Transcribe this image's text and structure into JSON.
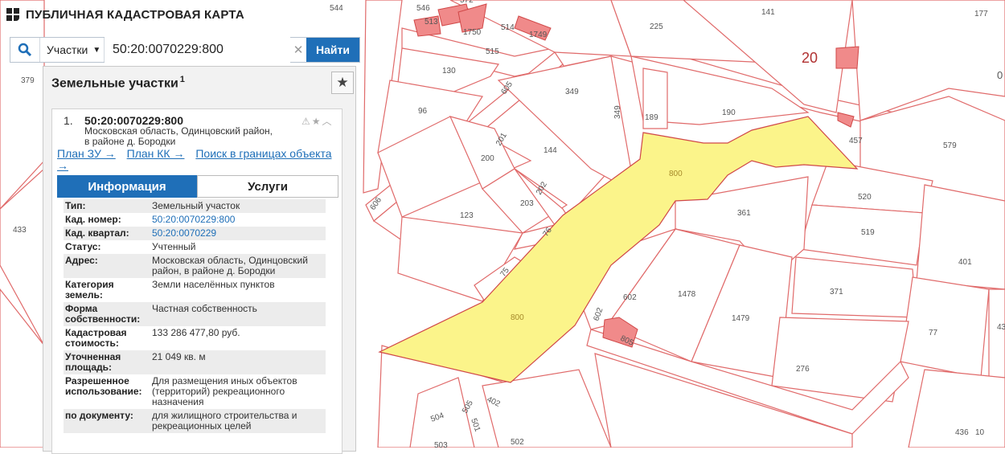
{
  "header": {
    "title": "ПУБЛИЧНАЯ КАДАСТРОВАЯ КАРТА",
    "logo_icon": "cadastre-logo-icon"
  },
  "search": {
    "search_icon": "search-icon",
    "type_label": "Участки",
    "query": "50:20:0070229:800",
    "find_label": "Найти"
  },
  "panel": {
    "title": "Земельные участки",
    "count": "1",
    "star_icon": "star-icon",
    "card": {
      "index": "1.",
      "cad_number": "50:20:0070229:800",
      "address_line1": "Московская область, Одинцовский район,",
      "address_line2": "в районе д. Бородки",
      "links": [
        "План ЗУ →",
        "План КК →",
        "Поиск в границах объекта →"
      ],
      "tabs": [
        "Информация",
        "Услуги"
      ],
      "info": [
        {
          "k": "Тип:",
          "v": "Земельный участок"
        },
        {
          "k": "Кад. номер:",
          "v": "50:20:0070229:800"
        },
        {
          "k": "Кад. квартал:",
          "v": "50:20:0070229"
        },
        {
          "k": "Статус:",
          "v": "Учтенный"
        },
        {
          "k": "Адрес:",
          "v": "Московская область, Одинцовский район, в районе д. Бородки"
        },
        {
          "k": "Категория земель:",
          "v": "Земли населённых пунктов"
        },
        {
          "k": "Форма собственности:",
          "v": "Частная собственность"
        },
        {
          "k": "Кадастровая стоимость:",
          "v": "133 286 477,80 руб."
        },
        {
          "k": "Уточненная площадь:",
          "v": "21 049 кв. м"
        },
        {
          "k": "Разрешенное использование:",
          "v": "Для размещения иных объектов (территорий) рекреационного назначения"
        },
        {
          "k": "по документу:",
          "v": "для жилищного строительства и рекреационных целей"
        }
      ]
    }
  },
  "map": {
    "selected_color": "#fbf48a",
    "border_color": "#e06a6a",
    "labels": [
      "379",
      "544",
      "546",
      "513",
      "572",
      "1750",
      "515",
      "514",
      "1749",
      "130",
      "605",
      "96",
      "349",
      "225",
      "141",
      "177",
      "20",
      "0",
      "433",
      "189",
      "190",
      "457",
      "579",
      "800",
      "200",
      "201",
      "202",
      "144",
      "203",
      "123",
      "606",
      "76",
      "75",
      "520",
      "361",
      "519",
      "401",
      "371",
      "602",
      "1478",
      "1479",
      "77",
      "805",
      "43",
      "276",
      "504",
      "505",
      "501",
      "402",
      "503",
      "502",
      "436",
      "10",
      "800"
    ]
  }
}
